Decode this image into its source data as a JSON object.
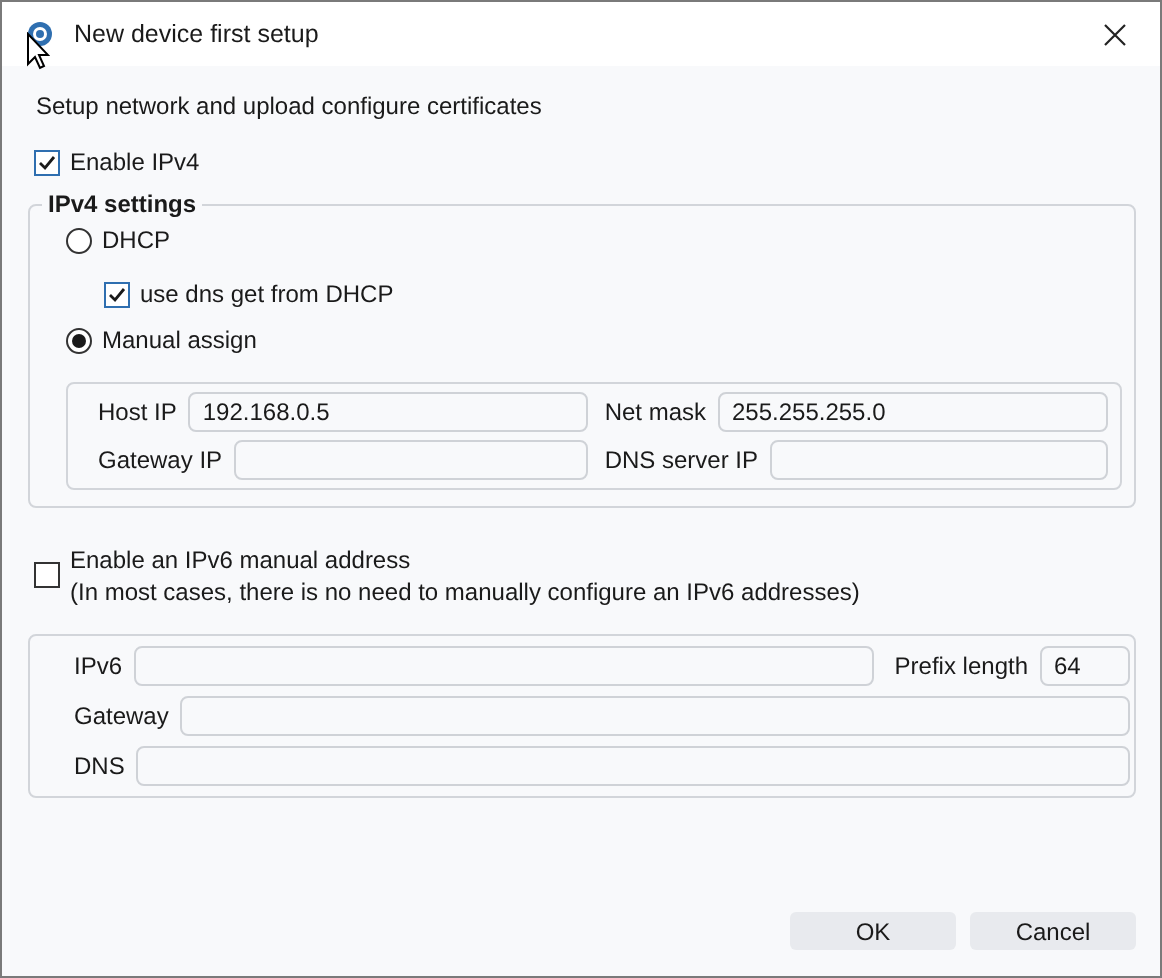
{
  "window": {
    "title": "New device first setup"
  },
  "subtitle": "Setup network and upload configure certificates",
  "enable_ipv4": {
    "label": "Enable IPv4",
    "checked": true
  },
  "ipv4_settings": {
    "legend": "IPv4 settings",
    "options": [
      {
        "label": "DHCP",
        "selected": false
      },
      {
        "label": "Manual assign",
        "selected": true
      }
    ],
    "use_dns_from_dhcp": {
      "label": "use dns get from DHCP",
      "checked": true
    },
    "fields": [
      {
        "label": "Host IP",
        "value": "192.168.0.5"
      },
      {
        "label": "Net mask",
        "value": "255.255.255.0"
      },
      {
        "label": "Gateway IP"
      },
      {
        "label": "DNS server IP"
      }
    ]
  },
  "enable_ipv6": {
    "label": "Enable an IPv6 manual address",
    "note": "(In most cases, there is no need to manually configure an IPv6 addresses)",
    "checked": false
  },
  "ipv6_settings": {
    "fields": [
      {
        "label": "IPv6"
      },
      {
        "label": "Prefix length",
        "value": "64"
      },
      {
        "label": "Gateway"
      },
      {
        "label": "DNS"
      }
    ]
  },
  "buttons": [
    "OK",
    "Cancel"
  ]
}
